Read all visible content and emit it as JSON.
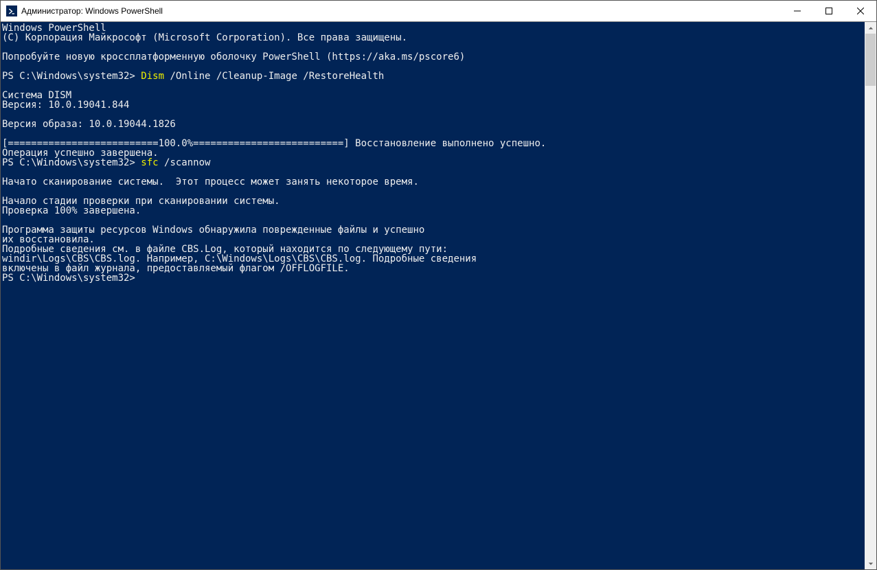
{
  "window": {
    "title": "Администратор: Windows PowerShell"
  },
  "term": {
    "header1": "Windows PowerShell",
    "header2": "(C) Корпорация Майкрософт (Microsoft Corporation). Все права защищены.",
    "tryline": "Попробуйте новую кроссплатформенную оболочку PowerShell (https://aka.ms/pscore6)",
    "prompt1a": "PS C:\\Windows\\system32> ",
    "prompt1_cmd": "Dism",
    "prompt1_args": " /Online /Cleanup-Image /RestoreHealth",
    "dism1": "Cистема DISM",
    "dism2": "Версия: 10.0.19041.844",
    "dism_img": "Версия образа: 10.0.19044.1826",
    "progress": "[==========================100.0%==========================] Восстановление выполнено успешно.",
    "done": "Операция успешно завершена.",
    "prompt2a": "PS C:\\Windows\\system32> ",
    "prompt2_cmd": "sfc",
    "prompt2_args": " /scannow",
    "sfc1": "Начато сканирование системы.  Этот процесс может занять некоторое время.",
    "sfc2": "Начало стадии проверки при сканировании системы.",
    "sfc3": "Проверка 100% завершена.",
    "sfc4": "Программа защиты ресурсов Windows обнаружила поврежденные файлы и успешно",
    "sfc5": "их восстановила.",
    "sfc6": "Подробные сведения см. в файле CBS.Log, который находится по следующему пути:",
    "sfc7": "windir\\Logs\\CBS\\CBS.log. Например, C:\\Windows\\Logs\\CBS\\CBS.log. Подробные сведения",
    "sfc8": "включены в файл журнала, предоставляемый флагом /OFFLOGFILE.",
    "prompt3": "PS C:\\Windows\\system32>"
  }
}
